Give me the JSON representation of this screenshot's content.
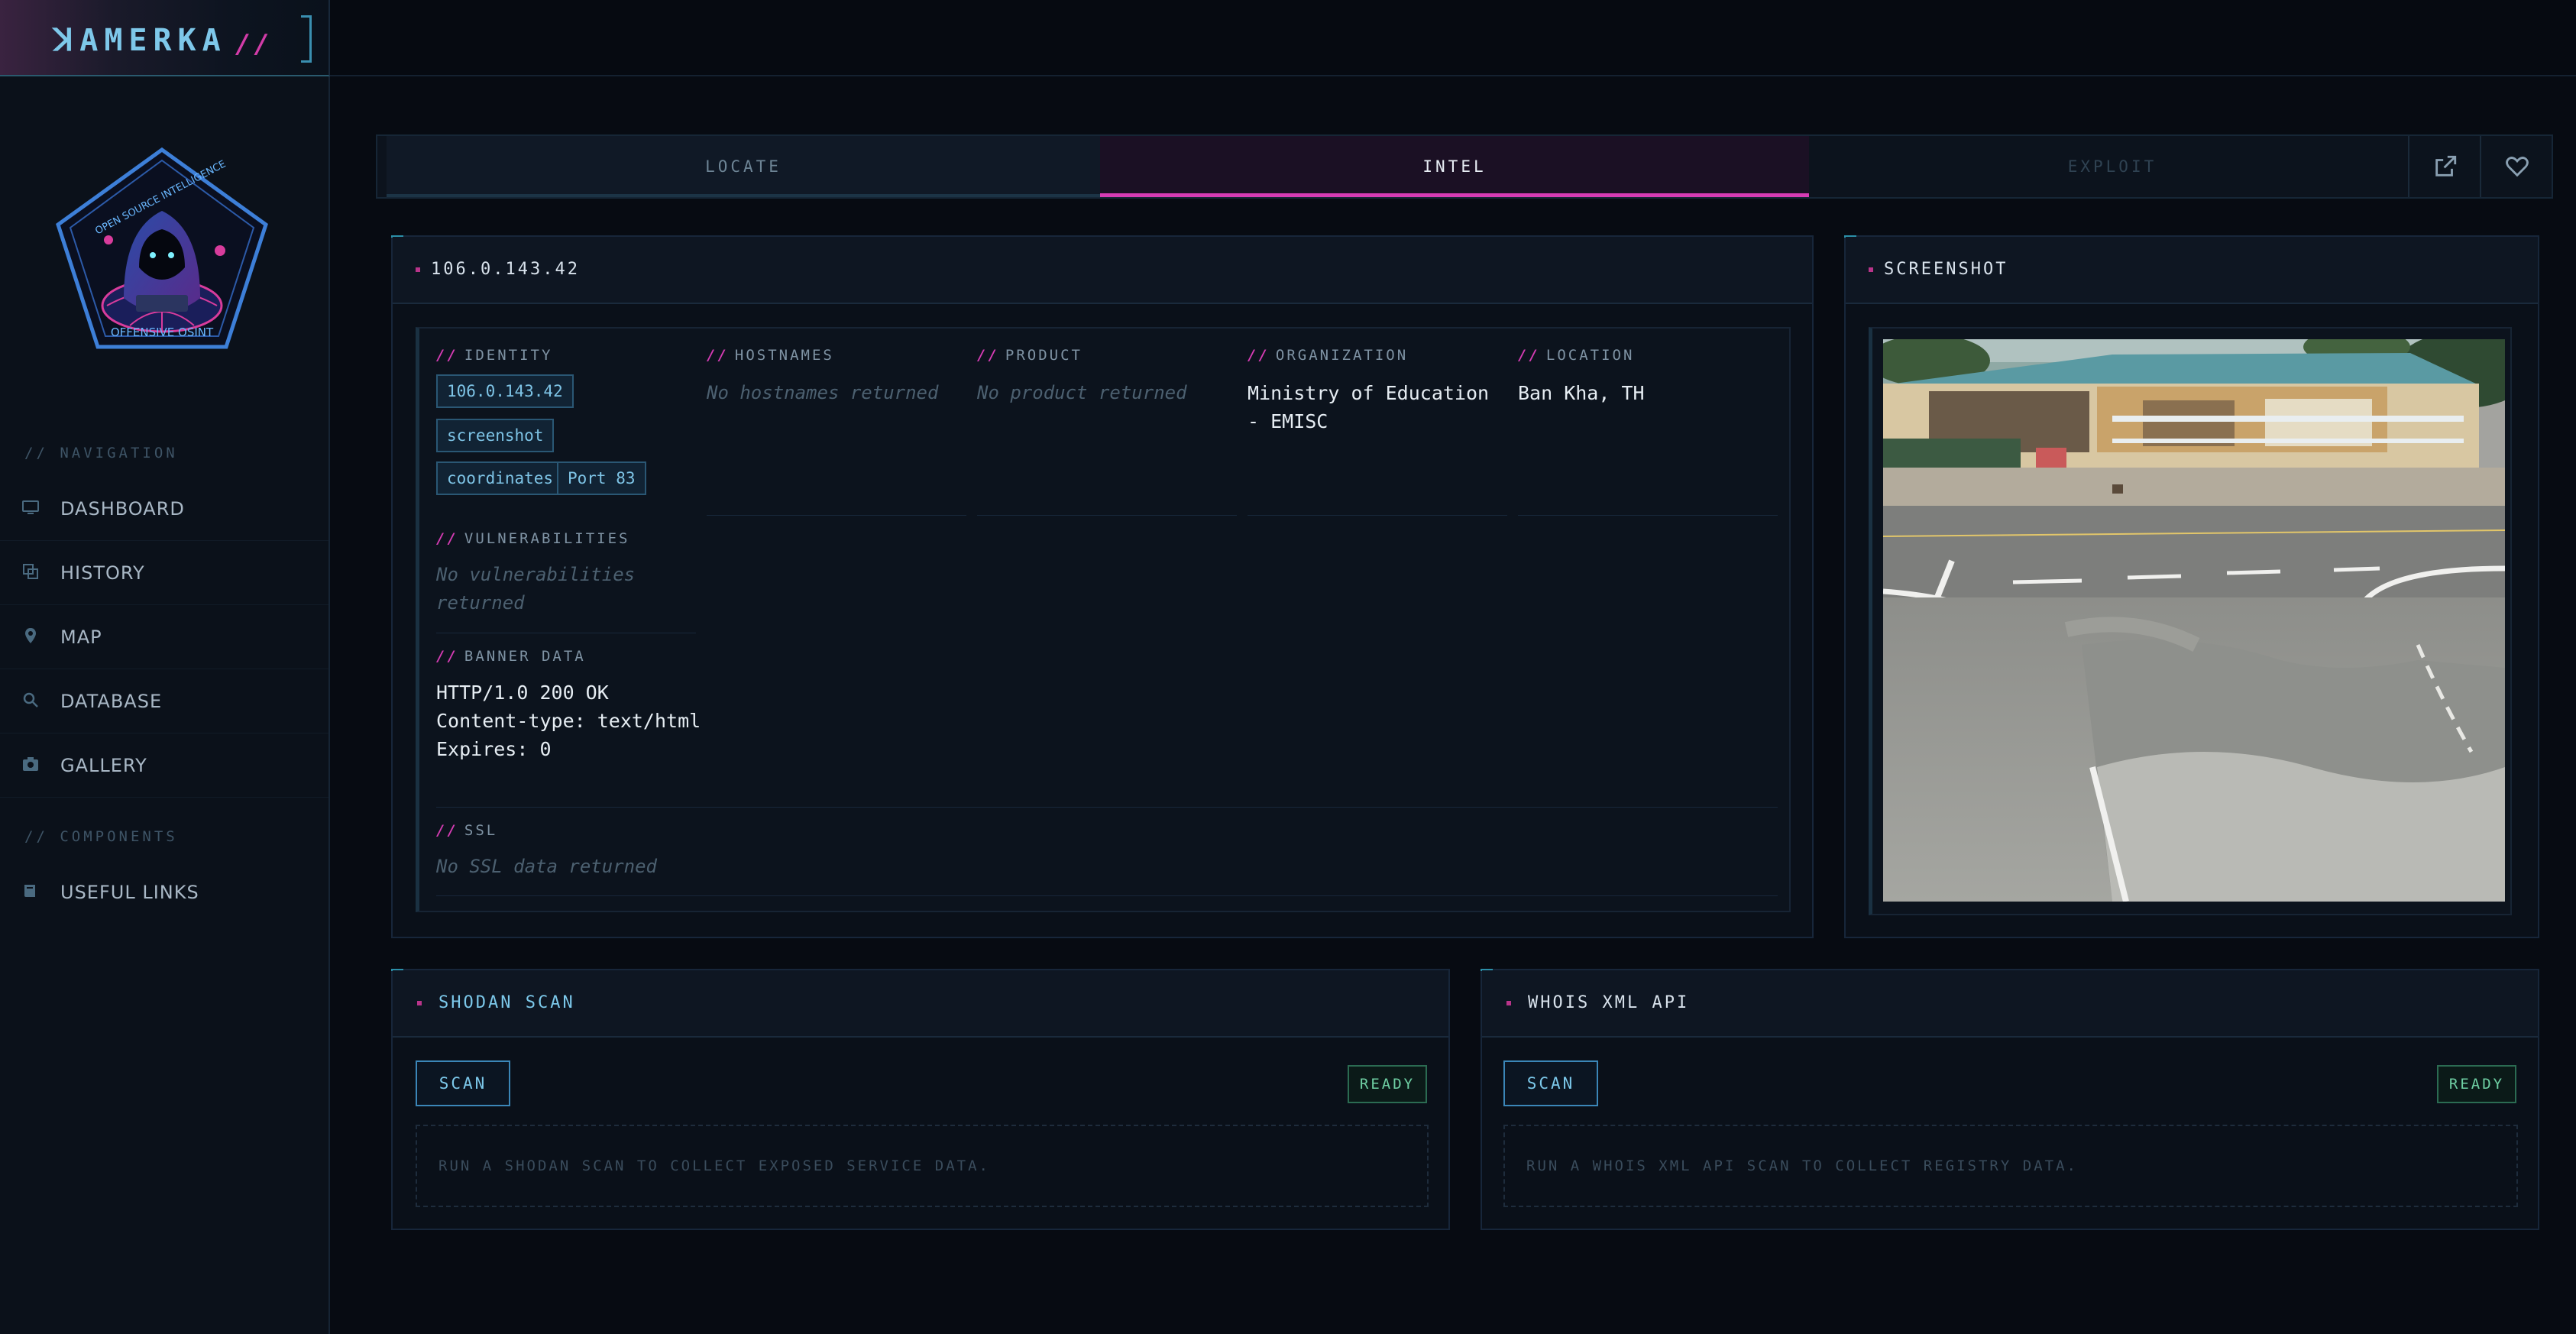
{
  "brand": {
    "name": "ꓘAMERKA",
    "slashes": "//"
  },
  "logo": {
    "top_text": "OPEN SOURCE INTELLIGENCE",
    "bottom_text": "OFFENSIVE OSINT"
  },
  "sidebar": {
    "nav_heading": "// NAVIGATION",
    "items": [
      {
        "label": "DASHBOARD",
        "icon": "monitor-icon"
      },
      {
        "label": "HISTORY",
        "icon": "history-icon"
      },
      {
        "label": "MAP",
        "icon": "map-pin-icon"
      },
      {
        "label": "DATABASE",
        "icon": "search-icon"
      },
      {
        "label": "GALLERY",
        "icon": "camera-icon"
      }
    ],
    "components_heading": "// COMPONENTS",
    "component_items": [
      {
        "label": "USEFUL LINKS",
        "icon": "book-icon"
      }
    ]
  },
  "tabs": [
    {
      "label": "LOCATE",
      "state": "inactive"
    },
    {
      "label": "INTEL",
      "state": "active"
    },
    {
      "label": "EXPLOIT",
      "state": "disabled"
    }
  ],
  "tab_actions": [
    {
      "icon": "external-link-icon"
    },
    {
      "icon": "heart-icon"
    }
  ],
  "intel": {
    "title": "106.0.143.42",
    "identity": {
      "label": "IDENTITY",
      "chips": [
        "106.0.143.42",
        "screenshot",
        "coordinates",
        "Port 83"
      ]
    },
    "hostnames": {
      "label": "HOSTNAMES",
      "value": "No hostnames returned"
    },
    "product": {
      "label": "PRODUCT",
      "value": "No product returned"
    },
    "organization": {
      "label": "ORGANIZATION",
      "value_line1": "Ministry of Education",
      "value_line2": "- EMISC"
    },
    "location": {
      "label": "LOCATION",
      "value": "Ban Kha, TH"
    },
    "vulnerabilities": {
      "label": "VULNERABILITIES",
      "value_line1": "No vulnerabilities",
      "value_line2": "returned"
    },
    "banner": {
      "label": "BANNER DATA",
      "lines": [
        "HTTP/1.0 200 OK",
        "Content-type: text/html",
        "Expires: 0"
      ]
    },
    "ssl": {
      "label": "SSL",
      "value": "No SSL data returned"
    },
    "slash": "//"
  },
  "screenshot": {
    "title": "SCREENSHOT"
  },
  "shodan": {
    "title": "SHODAN SCAN",
    "button": "SCAN",
    "status": "READY",
    "hint": "RUN A SHODAN SCAN TO COLLECT EXPOSED SERVICE DATA."
  },
  "whois": {
    "title": "WHOIS XML API",
    "button": "SCAN",
    "status": "READY",
    "hint": "RUN A WHOIS XML API SCAN TO COLLECT REGISTRY DATA."
  },
  "colors": {
    "accent_pink": "#d63cb4",
    "accent_cyan": "#7ec8ea",
    "ready_green": "#6fd0a4",
    "background": "#070b12"
  }
}
